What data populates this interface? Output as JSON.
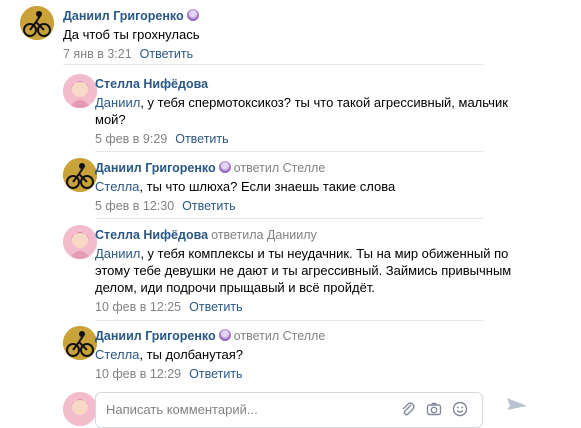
{
  "comments": [
    {
      "author": "Даниил Григоренко",
      "reply_to": "",
      "mention": "",
      "text_lines": [
        "Да чтоб ты грохнулась"
      ],
      "date": "7 янв в 3:21",
      "reply_label": "Ответить"
    },
    {
      "author": "Стелла Нифёдова",
      "reply_to": "",
      "mention": "Даниил",
      "text_lines": [
        ", у тебя спермотоксикоз? ты что такой агрессивный, мальчик",
        "мой?"
      ],
      "date": "5 фев в 9:29",
      "reply_label": "Ответить"
    },
    {
      "author": "Даниил Григоренко",
      "reply_to": "ответил Стелле",
      "mention": "Стелла",
      "text_lines": [
        ", ты что шлюха? Если знаешь такие слова"
      ],
      "date": "5 фев в 12:30",
      "reply_label": "Ответить"
    },
    {
      "author": "Стелла Нифёдова",
      "reply_to": "ответила Даниилу",
      "mention": "Даниил",
      "text_lines": [
        ", у тебя комплексы и ты неудачник. Ты на мир обиженный по",
        "этому тебе девушки не дают и ты агрессивный. Займись привычным",
        "делом, иди подрочи прыщавый и всё пройдёт."
      ],
      "date": "10 фев в 12:25",
      "reply_label": "Ответить"
    },
    {
      "author": "Даниил Григоренко",
      "reply_to": "ответил Стелле",
      "mention": "Стелла",
      "text_lines": [
        ", ты долбанутая?"
      ],
      "date": "10 фев в 12:29",
      "reply_label": "Ответить"
    }
  ],
  "composer": {
    "placeholder": "Написать комментарий..."
  },
  "icons": {
    "badge": "prometheus-badge-icon",
    "attach": "paperclip-icon",
    "camera": "camera-icon",
    "emoji": "emoji-icon",
    "send": "send-arrow-icon"
  },
  "colors": {
    "link": "#2a5885",
    "meta": "#828282",
    "separator": "#e7e8ec"
  }
}
